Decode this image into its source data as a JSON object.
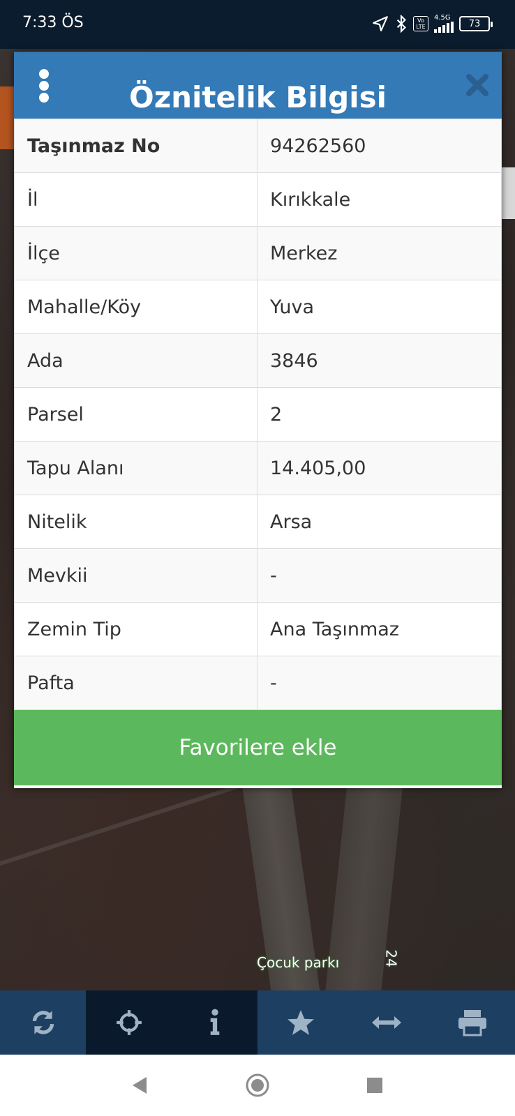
{
  "status_bar": {
    "time": "7:33 ÖS",
    "network": "4.5G",
    "volte": "Vo LTE",
    "battery": "73"
  },
  "dialog": {
    "title": "Öznitelik Bilgisi",
    "rows": [
      {
        "key": "Taşınmaz No",
        "value": "94262560"
      },
      {
        "key": "İl",
        "value": "Kırıkkale"
      },
      {
        "key": "İlçe",
        "value": "Merkez"
      },
      {
        "key": "Mahalle/Köy",
        "value": "Yuva"
      },
      {
        "key": "Ada",
        "value": "3846"
      },
      {
        "key": "Parsel",
        "value": "2"
      },
      {
        "key": "Tapu Alanı",
        "value": "14.405,00"
      },
      {
        "key": "Nitelik",
        "value": "Arsa"
      },
      {
        "key": "Mevkii",
        "value": "-"
      },
      {
        "key": "Zemin Tip",
        "value": "Ana Taşınmaz"
      },
      {
        "key": "Pafta",
        "value": "-"
      }
    ],
    "favorite_label": "Favorilere ekle"
  },
  "map": {
    "label": "Çocuk parkı",
    "label_2": "24"
  },
  "toolbar": {
    "items": [
      {
        "icon": "refresh-icon"
      },
      {
        "icon": "crosshair-icon"
      },
      {
        "icon": "info-icon",
        "active": true
      },
      {
        "icon": "star-icon"
      },
      {
        "icon": "measure-icon"
      },
      {
        "icon": "print-icon"
      }
    ]
  },
  "colors": {
    "header": "#337ab7",
    "favorite_button": "#5cb85c",
    "toolbar": "#1c3f62",
    "toolbar_active": "#0a1a2c"
  }
}
